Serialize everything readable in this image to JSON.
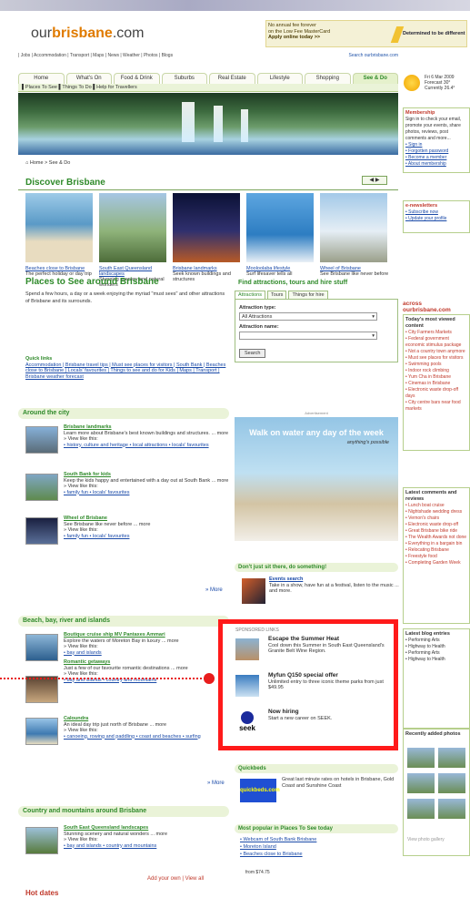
{
  "header": {
    "logo_pre": "our",
    "logo_b": "brisbane",
    "logo_post": ".com",
    "ad_line1": "No annual fee forever",
    "ad_line2": "on the Low Fee MasterCard",
    "ad_line3": "Apply online today >>",
    "ad_brand": "Determined to be different"
  },
  "links": {
    "left": "| Jobs | Accommodation | Transport | Maps | News | Weather | Photos | Blogs",
    "right": "Search ourbrisbane.com"
  },
  "tabs": [
    "Home",
    "What's On",
    "Food & Drink",
    "Suburbs",
    "Real Estate",
    "Lifestyle",
    "Shopping",
    "See & Do"
  ],
  "subnav": "▌Places To See ▌Things To Do ▌Help for Travellers",
  "breadcrumb": "⌂ Home > See & Do",
  "discover": {
    "title": "Discover Brisbane",
    "arrows": "◀ ▶",
    "items": [
      {
        "t": "Beaches close to Brisbane",
        "d": "The perfect holiday or day trip"
      },
      {
        "t": "South East Queensland landscapes",
        "d": "Stunning scenery and natural wonders"
      },
      {
        "t": "Brisbane landmarks",
        "d": "Seek known buildings and structures"
      },
      {
        "t": "Mooloolaba lifestyle",
        "d": "Surf lifesaver tells all"
      },
      {
        "t": "Wheel of Brisbane",
        "d": "See Brisbane like never before"
      }
    ]
  },
  "places": {
    "title": "Places to See around Brisbane",
    "desc": "Spend a few hours, a day or a week enjoying the myriad \"must sees\" and other attractions of Brisbane and its surrounds.",
    "quick_h": "Quick links",
    "quick": "Accommodation | Brisbane travel tips | Must see places for visitors | South Bank | Beaches close to Brisbane | Locals' favourites | Things to see and do for Kids | Maps | Transport | Brisbane weather forecast"
  },
  "find": {
    "title": "Find attractions, tours and hire stuff",
    "tabs": [
      "Attractions",
      "Tours",
      "Things for hire"
    ],
    "type_label": "Attraction type:",
    "type_value": "All Attractions",
    "name_label": "Attraction name:",
    "button": "Search"
  },
  "around": {
    "title": "Around the city",
    "more": "» More",
    "items": [
      {
        "t": "Brisbane landmarks",
        "d": "Learn more about Brisbane's best known buildings and structures. ... more",
        "v": "» View like this:",
        "l": "• history, culture and heritage • local attractions • locals' favourites"
      },
      {
        "t": "South Bank for kids",
        "d": "Keep the kids happy and entertained with a day out at South Bank ... more",
        "v": "» View like this:",
        "l": "• family fun • locals' favourites"
      },
      {
        "t": "Wheel of Brisbane",
        "d": "See Brisbane like never before ... more",
        "v": "» View like this:",
        "l": "• family fun • locals' favourites"
      }
    ]
  },
  "beach": {
    "title": "Beach, bay, river and islands",
    "more": "» More",
    "items": [
      {
        "t": "Boutique cruise ship MV Pantaxes Ammari",
        "d": "Explore the waters of Moreton Bay in luxury ... more",
        "v": "» View like this:",
        "l": "• bay and islands"
      },
      {
        "t": "Romantic getaways",
        "d": "Just a few of our favourite romantic destinations ... more",
        "v": "» View like this:",
        "l": "• bay and islands • country and mountains"
      },
      {
        "t": "Caloundra",
        "d": "An ideal day trip just north of Brisbane ... more",
        "v": "» View like this:",
        "l": "• canoeing, rowing and paddling • coast and beaches • surfing"
      }
    ]
  },
  "country": {
    "title": "Country and mountains around Brisbane",
    "items": [
      {
        "t": "South East Queensland landscapes",
        "d": "Stunning scenery and natural wonders ... more",
        "v": "» View like this:",
        "l": "• bay and islands • country and mountains"
      }
    ]
  },
  "walk": {
    "label": "Advertisement",
    "title": "Walk on water any day of the week",
    "sub": "anything's possible"
  },
  "dont": {
    "title": "Don't just sit there, do something!",
    "t": "Events search",
    "d": "Take in a show, have fun at a festival, listen to the music ... and more."
  },
  "sponsored": {
    "label": "SPONSORED LINKS",
    "items": [
      {
        "t": "Escape the Summer Heat",
        "d": "Cool down this Summer in South East Queensland's Granite Belt Wine Region."
      },
      {
        "t": "Myfun Q150 special offer",
        "d": "Unlimited entry to three iconic theme parks from just $49.95"
      },
      {
        "t": "Now hiring",
        "d": "Start a new career on SEEK."
      }
    ]
  },
  "seek": "seek",
  "quickbeds": {
    "title": "Quickbeds",
    "logo": "quickbeds.com",
    "d": "Great last minute rates on hotels in Brisbane, Gold Coast and Sunshine Coast"
  },
  "popular": {
    "title": "Most popular in Places To See today",
    "items": [
      "• Webcam of South Bank Brisbane",
      "• Moreton Island",
      "• Beaches close to Brisbane"
    ]
  },
  "addown": "Add your own | View all",
  "footad": "from $74.75",
  "hotd": "Hot dates",
  "side": {
    "weather": "Fri 6 Mar 2009 Forecast 30° Currently 26.4°",
    "membership": {
      "h": "Membership",
      "d": "Sign in to check your email, promote your events, share photos, reviews, post comments and more...",
      "l": [
        "• Sign in",
        "• Forgotten password",
        "• Become a member",
        "• About membership"
      ]
    },
    "enews": {
      "h": "e-newsletters",
      "l": [
        "• Subscribe now",
        "• Update your profile"
      ]
    },
    "across": "across ourbrisbane.com",
    "viewed": {
      "h": "Today's most viewed content",
      "l": [
        "• City Farmers Markets",
        "• Federal government economic stimulus package",
        "• Not a country town anymore",
        "• Must see places for visitors",
        "• Swimming pools",
        "• Indoor rock climbing",
        "• Yum Cha in Brisbane",
        "• Cinemas in Brisbane",
        "• Electronic waste drop-off days",
        "• City centre bars near food markets"
      ]
    },
    "comments": {
      "h": "Latest comments and reviews",
      "l": [
        "• Lunch boat cruise",
        "• Nightshade wedding dress",
        "• Vernon's chairs",
        "• Electronic waste drop-off",
        "• Great Brisbane bike ride",
        "• The Wealth Awards not done",
        "• Everything in a bargain bin",
        "• Relocating Brisbane",
        "• Freestyle food",
        "• Completing Garden Week"
      ]
    },
    "blogs": {
      "h": "Latest blog entries",
      "l": [
        "• Performing Arts",
        "• Highway to Health",
        "• Performing Arts",
        "• Highway to Health"
      ]
    },
    "photos": {
      "h": "Recently added photos",
      "foot": "View photo gallery"
    }
  }
}
